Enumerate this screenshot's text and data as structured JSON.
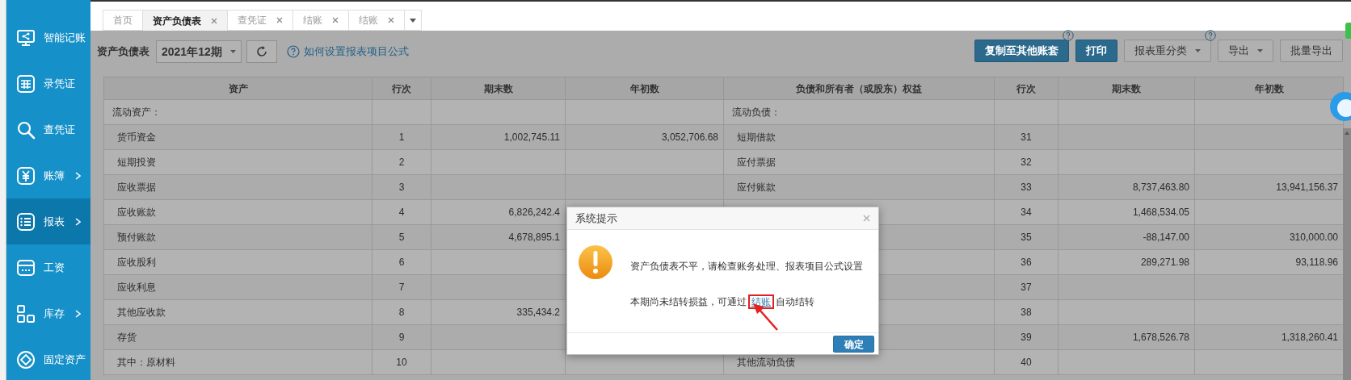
{
  "sidebar": {
    "items": [
      {
        "label": "智能记账",
        "has_submenu": false,
        "selected": false
      },
      {
        "label": "录凭证",
        "has_submenu": false,
        "selected": false
      },
      {
        "label": "查凭证",
        "has_submenu": false,
        "selected": false
      },
      {
        "label": "账簿",
        "has_submenu": true,
        "selected": false
      },
      {
        "label": "报表",
        "has_submenu": true,
        "selected": true
      },
      {
        "label": "工资",
        "has_submenu": false,
        "selected": false
      },
      {
        "label": "库存",
        "has_submenu": true,
        "selected": false
      },
      {
        "label": "固定资产",
        "has_submenu": false,
        "selected": false
      }
    ]
  },
  "tabs": [
    {
      "label": "首页",
      "closable": false,
      "selected": false
    },
    {
      "label": "资产负债表",
      "closable": true,
      "selected": true
    },
    {
      "label": "查凭证",
      "closable": true,
      "selected": false
    },
    {
      "label": "结账",
      "closable": true,
      "selected": false
    },
    {
      "label": "结账",
      "closable": true,
      "selected": false
    }
  ],
  "toolbar": {
    "title": "资产负债表",
    "period": "2021年12期",
    "help_link": "如何设置报表项目公式",
    "buttons": [
      {
        "label": "复制至其他账套",
        "kind": "primary",
        "help": true,
        "dropdown": false
      },
      {
        "label": "打印",
        "kind": "primary",
        "help": false,
        "dropdown": false
      },
      {
        "label": "报表重分类",
        "kind": "default",
        "help": true,
        "dropdown": true
      },
      {
        "label": "导出",
        "kind": "default",
        "help": false,
        "dropdown": true
      },
      {
        "label": "批量导出",
        "kind": "default",
        "help": false,
        "dropdown": false
      }
    ]
  },
  "table": {
    "columns": [
      "资产",
      "行次",
      "期末数",
      "年初数",
      "负债和所有者（或股东）权益",
      "行次",
      "期末数",
      "年初数"
    ],
    "rows": [
      {
        "kind": "section",
        "asset": "流动资产：",
        "liability": "流动负债："
      },
      {
        "kind": "item",
        "asset": "货币资金",
        "asset_line": "1",
        "asset_end": "1,002,745.11",
        "asset_begin": "3,052,706.68",
        "liability": "短期借款",
        "liability_line": "31"
      },
      {
        "kind": "item",
        "asset": "短期投资",
        "asset_line": "2",
        "liability": "应付票据",
        "liability_line": "32"
      },
      {
        "kind": "item",
        "asset": "应收票据",
        "asset_line": "3",
        "liability": "应付账款",
        "liability_line": "33",
        "liability_end": "8,737,463.80",
        "liability_begin": "13,941,156.37"
      },
      {
        "kind": "item",
        "asset": "应收账款",
        "asset_line": "4",
        "asset_end": "6,826,242.4",
        "liability_line": "34",
        "liability_end": "1,468,534.05"
      },
      {
        "kind": "item",
        "asset": "预付账款",
        "asset_line": "5",
        "asset_end": "4,678,895.1",
        "liability_line": "35",
        "liability_end": "-88,147.00",
        "liability_begin": "310,000.00"
      },
      {
        "kind": "item",
        "asset": "应收股利",
        "asset_line": "6",
        "liability_line": "36",
        "liability_end": "289,271.98",
        "liability_begin": "93,118.96"
      },
      {
        "kind": "item",
        "asset": "应收利息",
        "asset_line": "7",
        "liability_line": "37"
      },
      {
        "kind": "item",
        "asset": "其他应收款",
        "asset_line": "8",
        "asset_end": "335,434.2",
        "liability_line": "38"
      },
      {
        "kind": "item",
        "asset": "存货",
        "asset_line": "9",
        "liability_line": "39",
        "liability_end": "1,678,526.78",
        "liability_begin": "1,318,260.41"
      },
      {
        "kind": "item",
        "asset": "其中：原材料",
        "asset_line": "10",
        "liability": "其他流动负债",
        "liability_line": "40"
      }
    ]
  },
  "dialog": {
    "title": "系统提示",
    "message": "资产负债表不平，请检查账务处理、报表项目公式设置",
    "hint_prefix": "本期尚未结转损益，可通过",
    "hint_link": "结账",
    "hint_suffix": "自动结转",
    "link_highlighted": true,
    "ok_button": "确定"
  }
}
